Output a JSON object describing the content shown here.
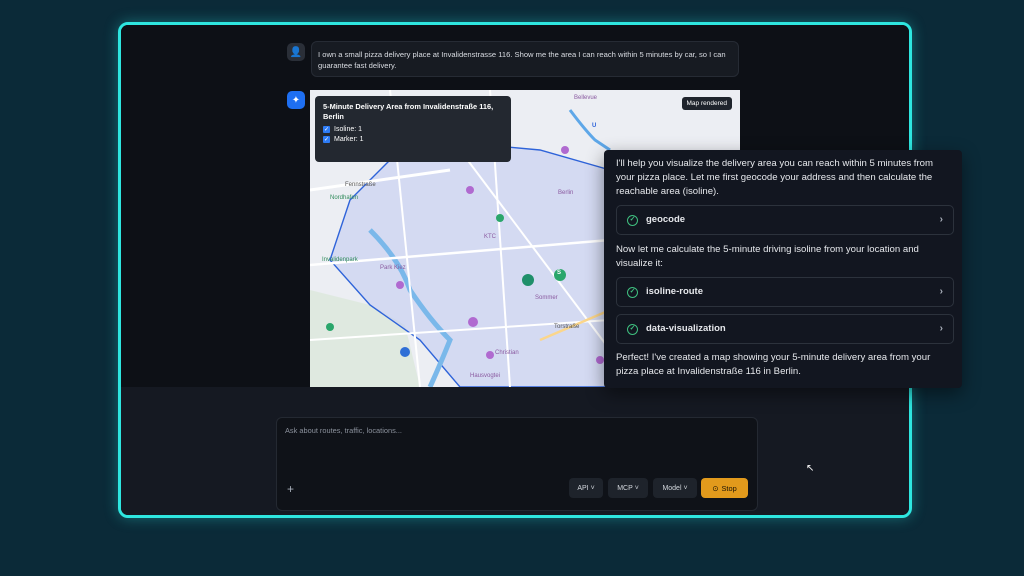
{
  "user_message": "I own a small pizza delivery place at Invalidenstrasse 116. Show me the area I can reach within 5 minutes by car, so I can guarantee fast delivery.",
  "map": {
    "legend_title": "5-Minute Delivery Area from Invalidenstraße 116, Berlin",
    "isoline_label": "Isoline: 1",
    "marker_label": "Marker: 1",
    "status_badge": "Map rendered",
    "labels": {
      "bellevue": "Bellevue",
      "fennstrasse": "Fennstraße",
      "nordhafen": "Nordhafen",
      "invalidenpark": "Invalidenpark",
      "park_kiez": "Park Kiez",
      "berlin": "Berlin",
      "ktc": "KTC",
      "sommer": "Sommer",
      "torstrasse": "Torstraße",
      "christian": "Christian",
      "hausvogtei": "Hausvogtei",
      "u": "U",
      "s": "S"
    }
  },
  "assistant": {
    "intro": "I'll help you visualize the delivery area you can reach within 5 minutes from your pizza place. Let me first geocode your address and then calculate the reachable area (isoline).",
    "tool1": "geocode",
    "middle": "Now let me calculate the 5-minute driving isoline from your location and visualize it:",
    "tool2": "isoline-route",
    "tool3": "data-visualization",
    "outro": "Perfect! I've created a map showing your 5-minute delivery area from your pizza place at Invalidenstraße 116 in Berlin."
  },
  "composer": {
    "placeholder": "Ask about routes, traffic, locations...",
    "plus": "+",
    "api": "API",
    "mcp": "MCP",
    "model": "Model",
    "stop": "Stop"
  },
  "colors": {
    "frame_border": "#2ee6e0",
    "stop_button": "#e29a1c",
    "isoline_fill": "#c5cdf2",
    "isoline_stroke": "#2e63d9"
  }
}
